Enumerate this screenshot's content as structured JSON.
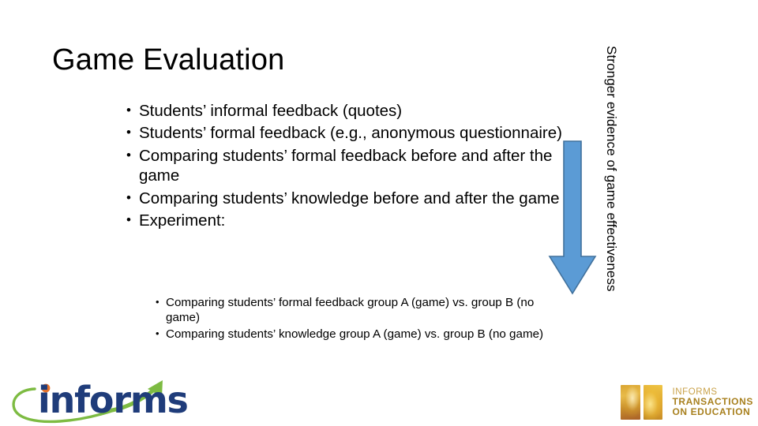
{
  "slide": {
    "title": "Game Evaluation",
    "background_color": "#FFFFFF"
  },
  "bullets": [
    {
      "marker": "•",
      "text": "Students’ informal feedback (quotes)"
    },
    {
      "marker": "•",
      "text": "Students’ formal feedback (e.g., anonymous questionnaire)"
    },
    {
      "marker": "•",
      "text": "Comparing students’ formal feedback before and after the game"
    },
    {
      "marker": "•",
      "text": "Comparing students’ knowledge before and after the game"
    },
    {
      "marker": "•",
      "text": "Experiment:"
    }
  ],
  "sub_bullets": [
    {
      "marker": "•",
      "text": "Comparing students’ formal feedback group A (game) vs. group B (no game)"
    },
    {
      "marker": "•",
      "text": "Comparing students’ knowledge group A (game) vs. group B (no game)"
    }
  ],
  "arrow": {
    "name": "down-arrow",
    "direction": "down",
    "fill_color": "#5B9BD5",
    "stroke_color": "#41719C"
  },
  "side_label": {
    "text": "Stronger evidence of game effectiveness",
    "orientation": "vertical-rotated-90",
    "color": "#000000"
  },
  "informs_logo": {
    "wordmark": "informs",
    "text_color": "#1F3C7A",
    "dot_color": "#E8732A",
    "swoosh_color": "#7DBB42"
  },
  "ite_logo": {
    "line1": "INFORMS",
    "line2": "TRANSACTIONS",
    "line3": "ON EDUCATION",
    "line1_color": "#C9A24A",
    "line2_color": "#A8801E",
    "line3_color": "#A8801E",
    "tile_color": "#D9A431"
  }
}
